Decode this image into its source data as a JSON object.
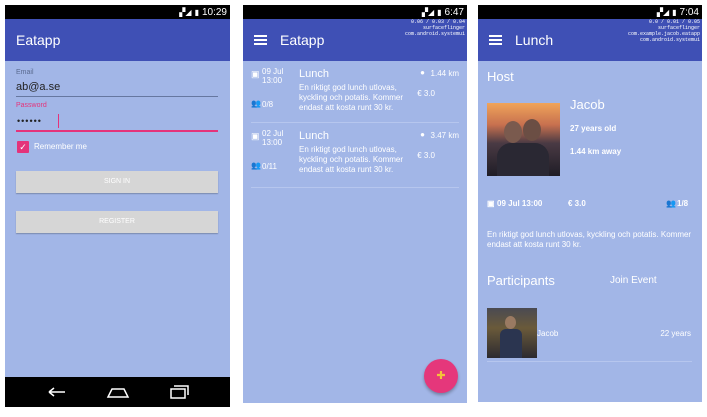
{
  "colors": {
    "background": "#a2b6e7",
    "appbar": "#3f50b5",
    "accent": "#e5377b"
  },
  "screen1": {
    "status_time": "10:29",
    "app_title": "Eatapp",
    "email_label": "Email",
    "email_value": "ab@a.se",
    "password_label": "Password",
    "password_value": "••••••",
    "remember_label": "Remember me",
    "signin_label": "SIGN IN",
    "register_label": "REGISTER"
  },
  "screen2": {
    "status_time": "6:47",
    "app_title": "Eatapp",
    "debug_text": "0.06 / 0.03 / 0.04\nsurfaceflinger\ncom.android.systemui",
    "events": [
      {
        "date": "09 Jul\n13:00",
        "title": "Lunch",
        "distance": "1.44 km",
        "description": "En riktigt god lunch utlovas, kyckling och potatis. Kommer endast att kosta runt 30 kr.",
        "price": "€ 3.0",
        "participants": "0/8"
      },
      {
        "date": "02 Jul\n13:00",
        "title": "Lunch",
        "distance": "3.47 km",
        "description": "En riktigt god lunch utlovas, kyckling och potatis. Kommer endast att kosta runt 30 kr.",
        "price": "€ 3.0",
        "participants": "0/11"
      }
    ]
  },
  "screen3": {
    "status_time": "7:04",
    "app_title": "Lunch",
    "debug_text": "0.0 / 0.01 / 0.05\nsurfaceflinger\ncom.example.jacob.eatapp\ncom.android.systemui",
    "host_heading": "Host",
    "host_name": "Jacob",
    "host_age": "27 years old",
    "host_distance": "1.44 km away",
    "event_date": "09 Jul 13:00",
    "event_price": "€ 3.0",
    "event_participants": "1/8",
    "event_description": "En riktigt god lunch utlovas, kyckling och potatis. Kommer endast att kosta runt 30 kr.",
    "participants_heading": "Participants",
    "join_label": "Join Event",
    "participants": [
      {
        "name": "Jacob",
        "age": "22 years"
      }
    ]
  }
}
